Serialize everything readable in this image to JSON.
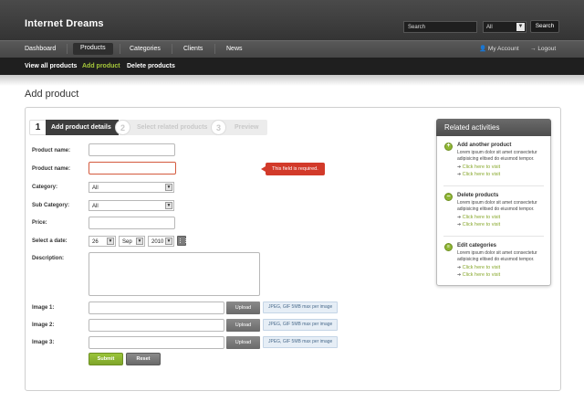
{
  "header": {
    "brand": "Internet Dreams",
    "brand_sub": "",
    "search_placeholder": "Search",
    "search_scope": "All",
    "search_button": "Search"
  },
  "nav": {
    "items": [
      "Dashboard",
      "Products",
      "Categories",
      "Clients",
      "News"
    ],
    "active": "Products",
    "account": "My Account",
    "logout": "Logout"
  },
  "subnav": {
    "items": [
      "View all products",
      "Add product",
      "Delete products"
    ],
    "active": "Add product"
  },
  "page": {
    "title": "Add product"
  },
  "steps": [
    {
      "num": "1",
      "label": "Add product details"
    },
    {
      "num": "2",
      "label": "Select related products"
    },
    {
      "num": "3",
      "label": "Preview"
    }
  ],
  "form": {
    "labels": {
      "name1": "Product name:",
      "name2": "Product name:",
      "category": "Category:",
      "subcategory": "Sub Category:",
      "price": "Price:",
      "date": "Select a date:",
      "description": "Description:",
      "image1": "Image 1:",
      "image2": "Image 2:",
      "image3": "Image 3:"
    },
    "category_value": "All",
    "subcategory_value": "All",
    "date": {
      "day": "26",
      "month": "Sep",
      "year": "2010"
    },
    "error_message": "This field is required.",
    "upload_label": "Upload",
    "upload_hint": "JPEG, GIF 5MB max per image",
    "submit": "Submit",
    "reset": "Reset"
  },
  "related": {
    "title": "Related activities",
    "items": [
      {
        "title": "Add another product",
        "desc": "Lorem ipsum dolor sit amet consectetur adipisicing elitsed do eiusmod tempor.",
        "link1": "Click here to visit",
        "link2": "Click here to visit",
        "icon": "plus-icon"
      },
      {
        "title": "Delete products",
        "desc": "Lorem ipsum dolor sit amet consectetur adipisicing elitsed do eiusmod tempor.",
        "link1": "Click here to visit",
        "link2": "Click here to visit",
        "icon": "minus-icon"
      },
      {
        "title": "Edit categories",
        "desc": "Lorem ipsum dolor sit amet consectetur adipisicing elitsed do eiusmod tempor.",
        "link1": "Click here to visit",
        "link2": "Click here to visit",
        "icon": "list-icon"
      }
    ]
  },
  "colors": {
    "accent": "#87a82c",
    "error": "#d23a2a",
    "header": "#3a3a3a"
  }
}
